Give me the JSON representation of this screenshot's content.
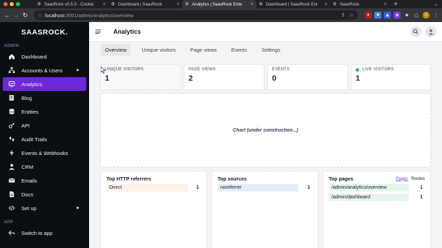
{
  "browser": {
    "traffic_lights": [
      "#ff5f57",
      "#febc2e",
      "#28c840"
    ],
    "tabs": [
      {
        "title": "SaasRock v0.5.0 - Cookie",
        "active": false
      },
      {
        "title": "Dashboard | SaasRock",
        "active": false
      },
      {
        "title": "Analytics | SaasRock Ente",
        "active": true
      },
      {
        "title": "Dashboard | SaasRock Ent",
        "active": false
      },
      {
        "title": "SaasRock",
        "active": false
      }
    ],
    "url_host": "localhost",
    "url_path": ":3001/admin/analytics/overview"
  },
  "sidebar": {
    "brand": "SAASROCK.",
    "section_admin": "ADMIN",
    "section_app": "APP",
    "items": [
      {
        "label": "Dashboard",
        "icon": "home-icon",
        "caret": false
      },
      {
        "label": "Accounts & Users",
        "icon": "accounts-icon",
        "caret": true
      },
      {
        "label": "Analytics",
        "icon": "analytics-icon",
        "caret": false,
        "active": true
      },
      {
        "label": "Blog",
        "icon": "blog-icon",
        "caret": false
      },
      {
        "label": "Entities",
        "icon": "database-icon",
        "caret": false
      },
      {
        "label": "API",
        "icon": "key-icon",
        "caret": false
      },
      {
        "label": "Audit Trails",
        "icon": "footsteps-icon",
        "caret": false
      },
      {
        "label": "Events & Webhooks",
        "icon": "lightning-icon",
        "caret": false
      },
      {
        "label": "CRM",
        "icon": "user-icon",
        "caret": false
      },
      {
        "label": "Emails",
        "icon": "mail-icon",
        "caret": false
      },
      {
        "label": "Docs",
        "icon": "docs-icon",
        "caret": false
      },
      {
        "label": "Set up",
        "icon": "code-icon",
        "caret": true
      }
    ],
    "app_item": {
      "label": "Switch to app",
      "icon": "back-arrow-icon"
    }
  },
  "header": {
    "title": "Analytics"
  },
  "tabs": [
    {
      "label": "Overview",
      "active": true
    },
    {
      "label": "Unique visitors",
      "active": false
    },
    {
      "label": "Page views",
      "active": false
    },
    {
      "label": "Events",
      "active": false
    },
    {
      "label": "Settings",
      "active": false
    }
  ],
  "stats": [
    {
      "label": "UNIQUE VISITORS",
      "value": "1"
    },
    {
      "label": "PAGE VIEWS",
      "value": "2"
    },
    {
      "label": "EVENTS",
      "value": "0"
    },
    {
      "label": "LIVE VISITORS",
      "value": "1"
    }
  ],
  "chart_placeholder": "Chart (under construction...)",
  "panels": {
    "referrers": {
      "title": "Top HTTP referrers",
      "rows": [
        {
          "label": "Direct",
          "count": "1",
          "color": "#fdf2e9"
        }
      ]
    },
    "sources": {
      "title": "Top sources",
      "rows": [
        {
          "label": "noreferrer",
          "count": "1",
          "color": "#e6ecf7"
        }
      ]
    },
    "pages": {
      "title": "Top pages",
      "link_pages": "Pages",
      "link_routes": "Routes",
      "rows": [
        {
          "label": "/admin/analytics/overview",
          "count": "1",
          "color": "#e6f5ec"
        },
        {
          "label": "/admin/dashboard",
          "count": "1",
          "color": "#e6f5ec"
        }
      ]
    }
  },
  "colors": {
    "accent": "#6d28d9",
    "live": "#22c55e"
  }
}
